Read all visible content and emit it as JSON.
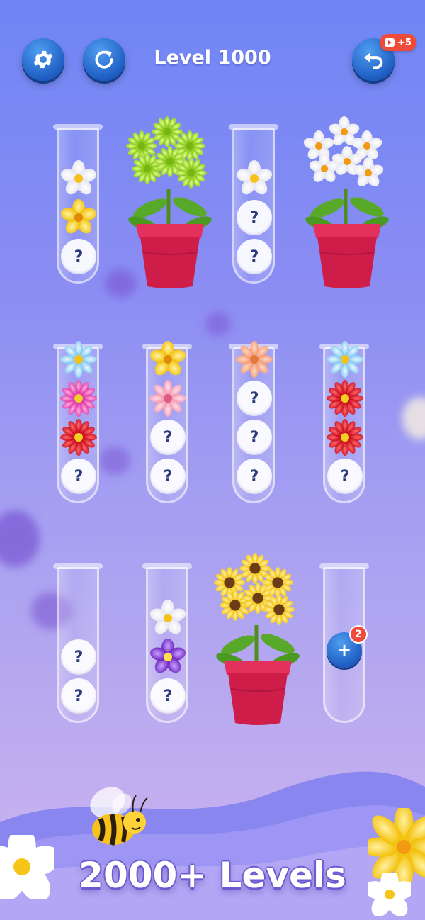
{
  "header": {
    "title": "Level 1000",
    "settings_icon": "gear-icon",
    "restart_icon": "restart-icon",
    "undo_icon": "undo-icon",
    "undo_badge": "+5"
  },
  "hidden_marker": "?",
  "tubes": [
    {
      "id": "tube-r1-c1",
      "slots": [
        "hidden",
        "yellow-flower",
        "white-daisy"
      ]
    },
    {
      "id": "tube-r1-c3",
      "slots": [
        "hidden",
        "hidden",
        "white-daisy"
      ]
    },
    {
      "id": "tube-r2-c1",
      "slots": [
        "hidden",
        "red-flower",
        "pink-flower",
        "blue-flower"
      ]
    },
    {
      "id": "tube-r2-c2",
      "slots": [
        "hidden",
        "hidden",
        "light-pink-flower",
        "yellow-flower"
      ]
    },
    {
      "id": "tube-r2-c3",
      "slots": [
        "hidden",
        "hidden",
        "hidden",
        "peach-flower"
      ]
    },
    {
      "id": "tube-r2-c4",
      "slots": [
        "hidden",
        "red-flower",
        "red-flower",
        "blue-flower"
      ]
    },
    {
      "id": "tube-r3-c1",
      "slots": [
        "hidden",
        "hidden"
      ]
    },
    {
      "id": "tube-r3-c2",
      "slots": [
        "hidden",
        "purple-pansy",
        "white-daisy"
      ]
    },
    {
      "id": "tube-r3-c4",
      "slots": []
    }
  ],
  "completed_pots": [
    {
      "id": "pot-green",
      "flower": "green-flower"
    },
    {
      "id": "pot-white",
      "flower": "white-narcissus"
    },
    {
      "id": "pot-sunflower",
      "flower": "sunflower"
    }
  ],
  "add_tube": {
    "icon": "plus-icon",
    "count": "2"
  },
  "footer": {
    "text": "2000+ Levels"
  },
  "colors": {
    "button_blue": "#1f5ec4",
    "badge_red": "#f04b3a",
    "pot_red": "#d7234f"
  }
}
